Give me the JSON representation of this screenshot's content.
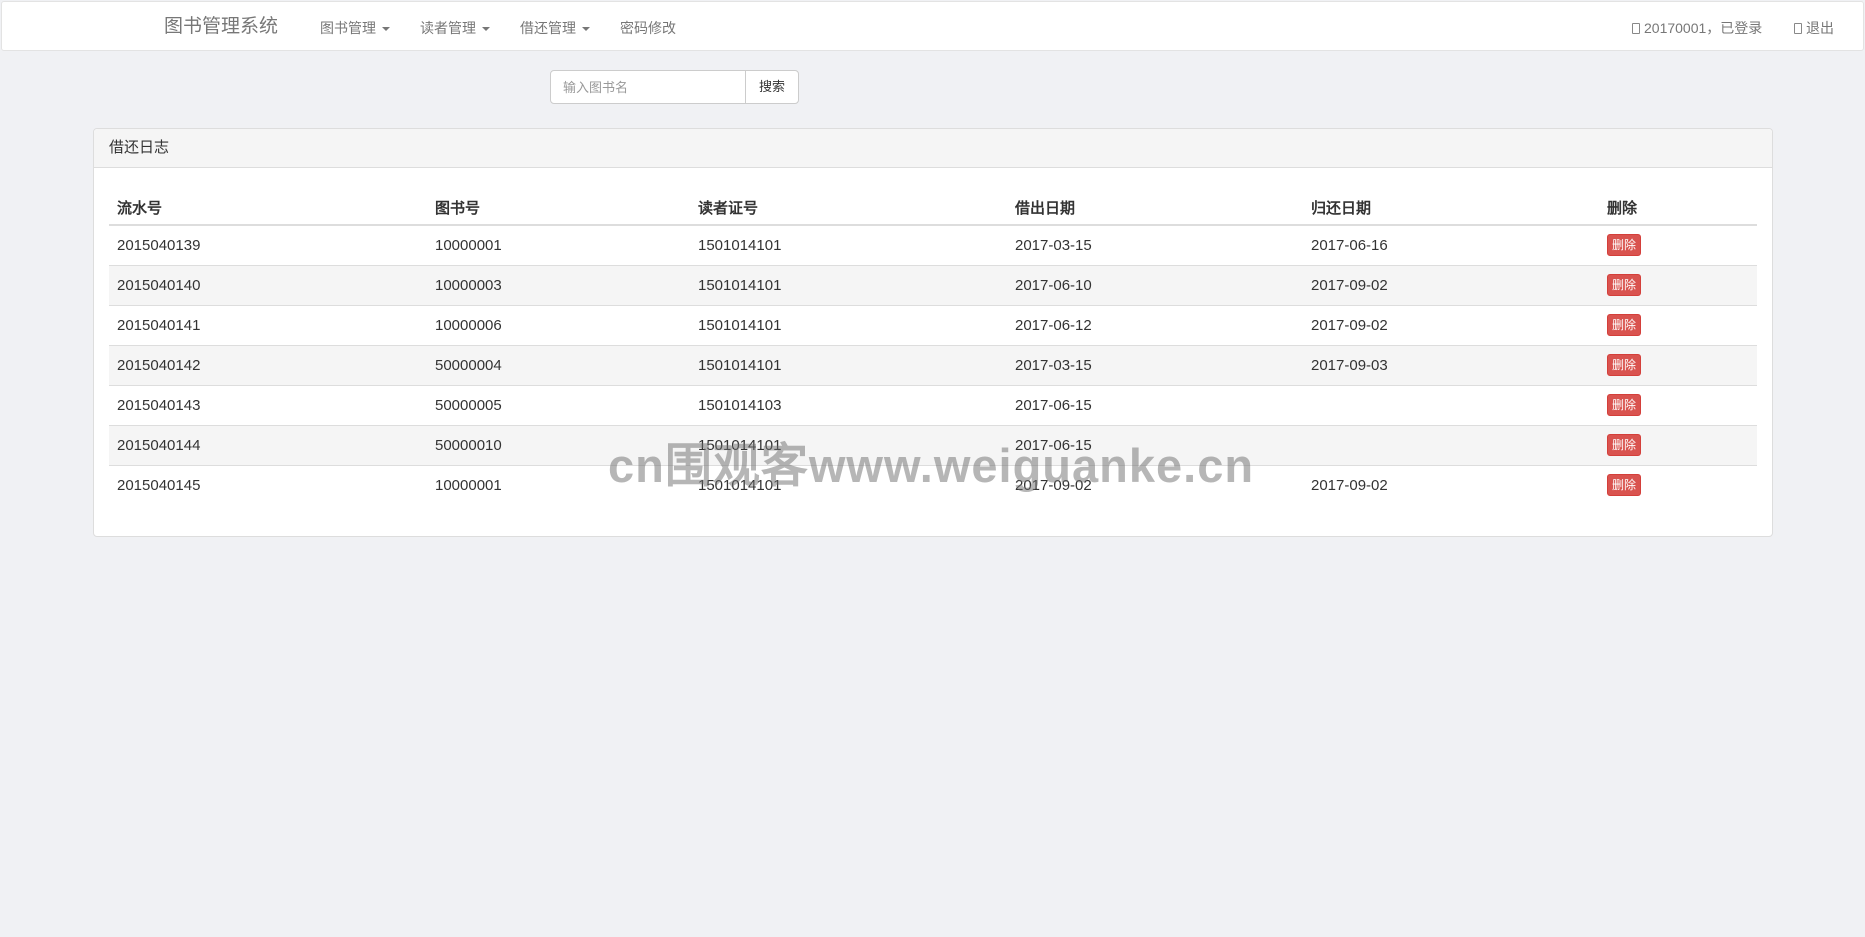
{
  "navbar": {
    "brand": "图书管理系统",
    "menu": [
      {
        "label": "图书管理",
        "dropdown": true
      },
      {
        "label": "读者管理",
        "dropdown": true
      },
      {
        "label": "借还管理",
        "dropdown": true
      },
      {
        "label": "密码修改",
        "dropdown": false
      }
    ],
    "user_status": "20170001，已登录",
    "logout": "退出"
  },
  "search": {
    "placeholder": "输入图书名",
    "button_label": "搜索"
  },
  "panel": {
    "title": "借还日志",
    "table": {
      "headers": [
        "流水号",
        "图书号",
        "读者证号",
        "借出日期",
        "归还日期",
        "删除"
      ],
      "delete_label": "删除",
      "rows": [
        [
          "2015040139",
          "10000001",
          "1501014101",
          "2017-03-15",
          "2017-06-16"
        ],
        [
          "2015040140",
          "10000003",
          "1501014101",
          "2017-06-10",
          "2017-09-02"
        ],
        [
          "2015040141",
          "10000006",
          "1501014101",
          "2017-06-12",
          "2017-09-02"
        ],
        [
          "2015040142",
          "50000004",
          "1501014101",
          "2017-03-15",
          "2017-09-03"
        ],
        [
          "2015040143",
          "50000005",
          "1501014103",
          "2017-06-15",
          ""
        ],
        [
          "2015040144",
          "50000010",
          "1501014101",
          "2017-06-15",
          ""
        ],
        [
          "2015040145",
          "10000001",
          "1501014101",
          "2017-09-02",
          "2017-09-02"
        ]
      ]
    }
  },
  "watermark": "cn围观客www.weiguanke.cn",
  "colors": {
    "background": "#f0f1f4",
    "danger": "#d9534f",
    "nav_text": "#777777"
  },
  "icons": {
    "user": "user-icon",
    "logout": "logout-icon"
  }
}
